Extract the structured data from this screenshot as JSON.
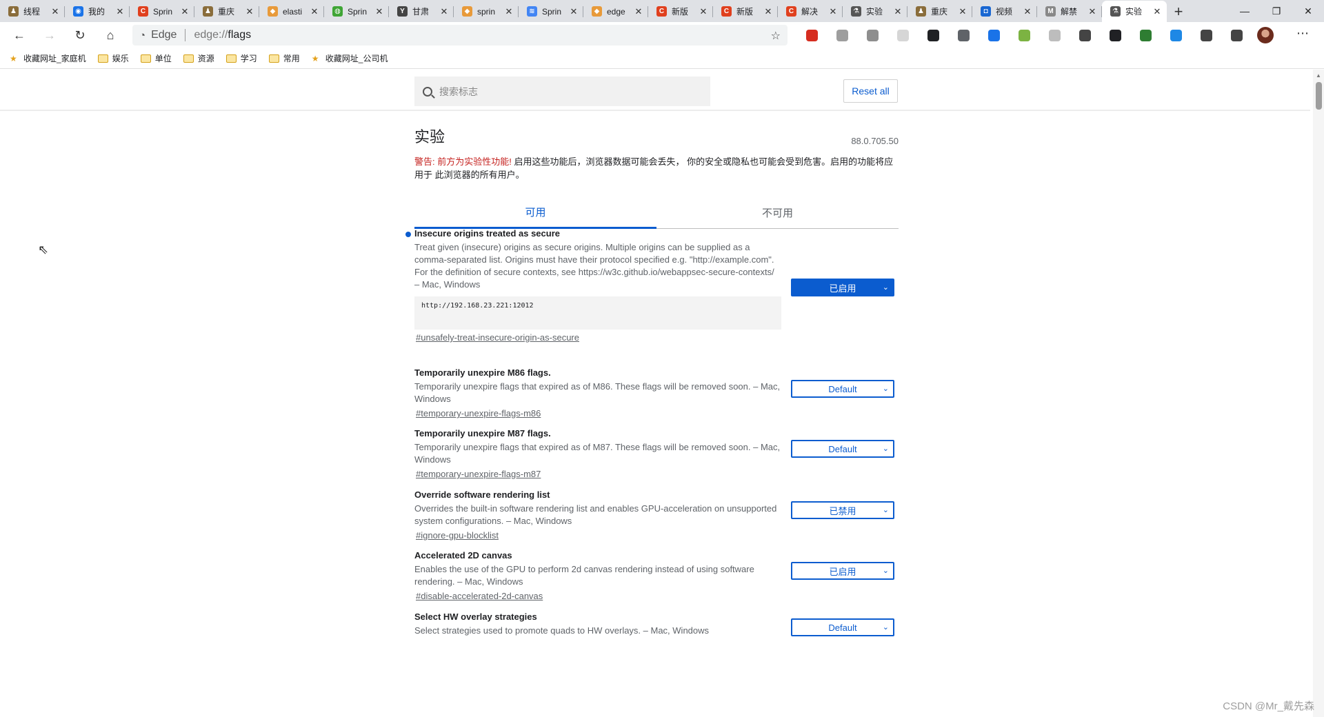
{
  "tabs": [
    {
      "title": "线程",
      "color": "#8a6d3b",
      "glyph": "♟"
    },
    {
      "title": "我的",
      "color": "#1a73e8",
      "glyph": "◉"
    },
    {
      "title": "Sprin",
      "color": "#e0401e",
      "glyph": "C"
    },
    {
      "title": "重庆",
      "color": "#8a6d3b",
      "glyph": "♟"
    },
    {
      "title": "elasti",
      "color": "#e89a3a",
      "glyph": "◆"
    },
    {
      "title": "Sprin",
      "color": "#3fa535",
      "glyph": "◍"
    },
    {
      "title": "甘肃",
      "color": "#444444",
      "glyph": "Y"
    },
    {
      "title": "sprin",
      "color": "#e89a3a",
      "glyph": "◆"
    },
    {
      "title": "Sprin",
      "color": "#4285f4",
      "glyph": "≋"
    },
    {
      "title": "edge",
      "color": "#e89a3a",
      "glyph": "◆"
    },
    {
      "title": "新版",
      "color": "#e0401e",
      "glyph": "C"
    },
    {
      "title": "新版",
      "color": "#e0401e",
      "glyph": "C"
    },
    {
      "title": "解决",
      "color": "#e0401e",
      "glyph": "C"
    },
    {
      "title": "实验",
      "color": "#555555",
      "glyph": "⚗"
    },
    {
      "title": "重庆",
      "color": "#8a6d3b",
      "glyph": "♟"
    },
    {
      "title": "视频",
      "color": "#1967d2",
      "glyph": "◘"
    },
    {
      "title": "解禁",
      "color": "#888888",
      "glyph": "M"
    },
    {
      "title": "实验",
      "color": "#555555",
      "glyph": "⚗",
      "active": true
    }
  ],
  "window": {
    "minimize": "—",
    "maximize": "❐",
    "close": "✕"
  },
  "toolbar": {
    "brand": "Edge",
    "url_scheme": "edge://",
    "url_path": "flags",
    "extensions": [
      {
        "name": "abp",
        "color": "#d62d20"
      },
      {
        "name": "cloud",
        "color": "#9e9e9e"
      },
      {
        "name": "shield",
        "color": "#8e8e8e"
      },
      {
        "name": "tab",
        "color": "#d6d6d6"
      },
      {
        "name": "game",
        "color": "#202124"
      },
      {
        "name": "cursor",
        "color": "#5f6368"
      },
      {
        "name": "globe",
        "color": "#1a73e8"
      },
      {
        "name": "yoyo",
        "color": "#7cb342"
      },
      {
        "name": "moon",
        "color": "#bdbdbd"
      },
      {
        "name": "screenshot",
        "color": "#444444"
      },
      {
        "name": "terminal",
        "color": "#202124"
      },
      {
        "name": "earth",
        "color": "#2e7d32"
      },
      {
        "name": "chart",
        "color": "#1e88e5"
      },
      {
        "name": "favorites",
        "color": "#444444"
      },
      {
        "name": "collections",
        "color": "#444444"
      }
    ]
  },
  "bookmarks": [
    {
      "label": "收藏网址_家庭机",
      "type": "site"
    },
    {
      "label": "娱乐",
      "type": "folder"
    },
    {
      "label": "单位",
      "type": "folder"
    },
    {
      "label": "资源",
      "type": "folder"
    },
    {
      "label": "学习",
      "type": "folder"
    },
    {
      "label": "常用",
      "type": "folder"
    },
    {
      "label": "收藏网址_公司机",
      "type": "site"
    }
  ],
  "page": {
    "search_placeholder": "搜索标志",
    "reset_label": "Reset all",
    "heading": "实验",
    "version": "88.0.705.50",
    "warning_red": "警告: 前方为实验性功能!",
    "warning_text": " 启用这些功能后，浏览器数据可能会丢失， 你的安全或隐私也可能会受到危害。启用的功能将应用于 此浏览器的所有用户。",
    "tab_available": "可用",
    "tab_unavailable": "不可用"
  },
  "flags": [
    {
      "title": "Insecure origins treated as secure",
      "desc": "Treat given (insecure) origins as secure origins. Multiple origins can be supplied as a comma-separated list. Origins must have their protocol specified e.g. \"http://example.com\". For the definition of secure contexts, see https://w3c.github.io/webappsec-secure-contexts/ – Mac, Windows",
      "input_value": "http://192.168.23.221:12012",
      "link": "#unsafely-treat-insecure-origin-as-secure",
      "select": "已启用",
      "modified": true
    },
    {
      "title": "Temporarily unexpire M86 flags.",
      "desc": "Temporarily unexpire flags that expired as of M86. These flags will be removed soon. – Mac, Windows",
      "link": "#temporary-unexpire-flags-m86",
      "select": "Default"
    },
    {
      "title": "Temporarily unexpire M87 flags.",
      "desc": "Temporarily unexpire flags that expired as of M87. These flags will be removed soon. – Mac, Windows",
      "link": "#temporary-unexpire-flags-m87",
      "select": "Default"
    },
    {
      "title": "Override software rendering list",
      "desc": "Overrides the built-in software rendering list and enables GPU-acceleration on unsupported system configurations. – Mac, Windows",
      "link": "#ignore-gpu-blocklist",
      "select": "已禁用"
    },
    {
      "title": "Accelerated 2D canvas",
      "desc": "Enables the use of the GPU to perform 2d canvas rendering instead of using software rendering. – Mac, Windows",
      "link": "#disable-accelerated-2d-canvas",
      "select": "已启用"
    },
    {
      "title": "Select HW overlay strategies",
      "desc": "Select strategies used to promote quads to HW overlays. – Mac, Windows",
      "select": "Default"
    }
  ],
  "watermark": "CSDN @Mr_戴先森"
}
